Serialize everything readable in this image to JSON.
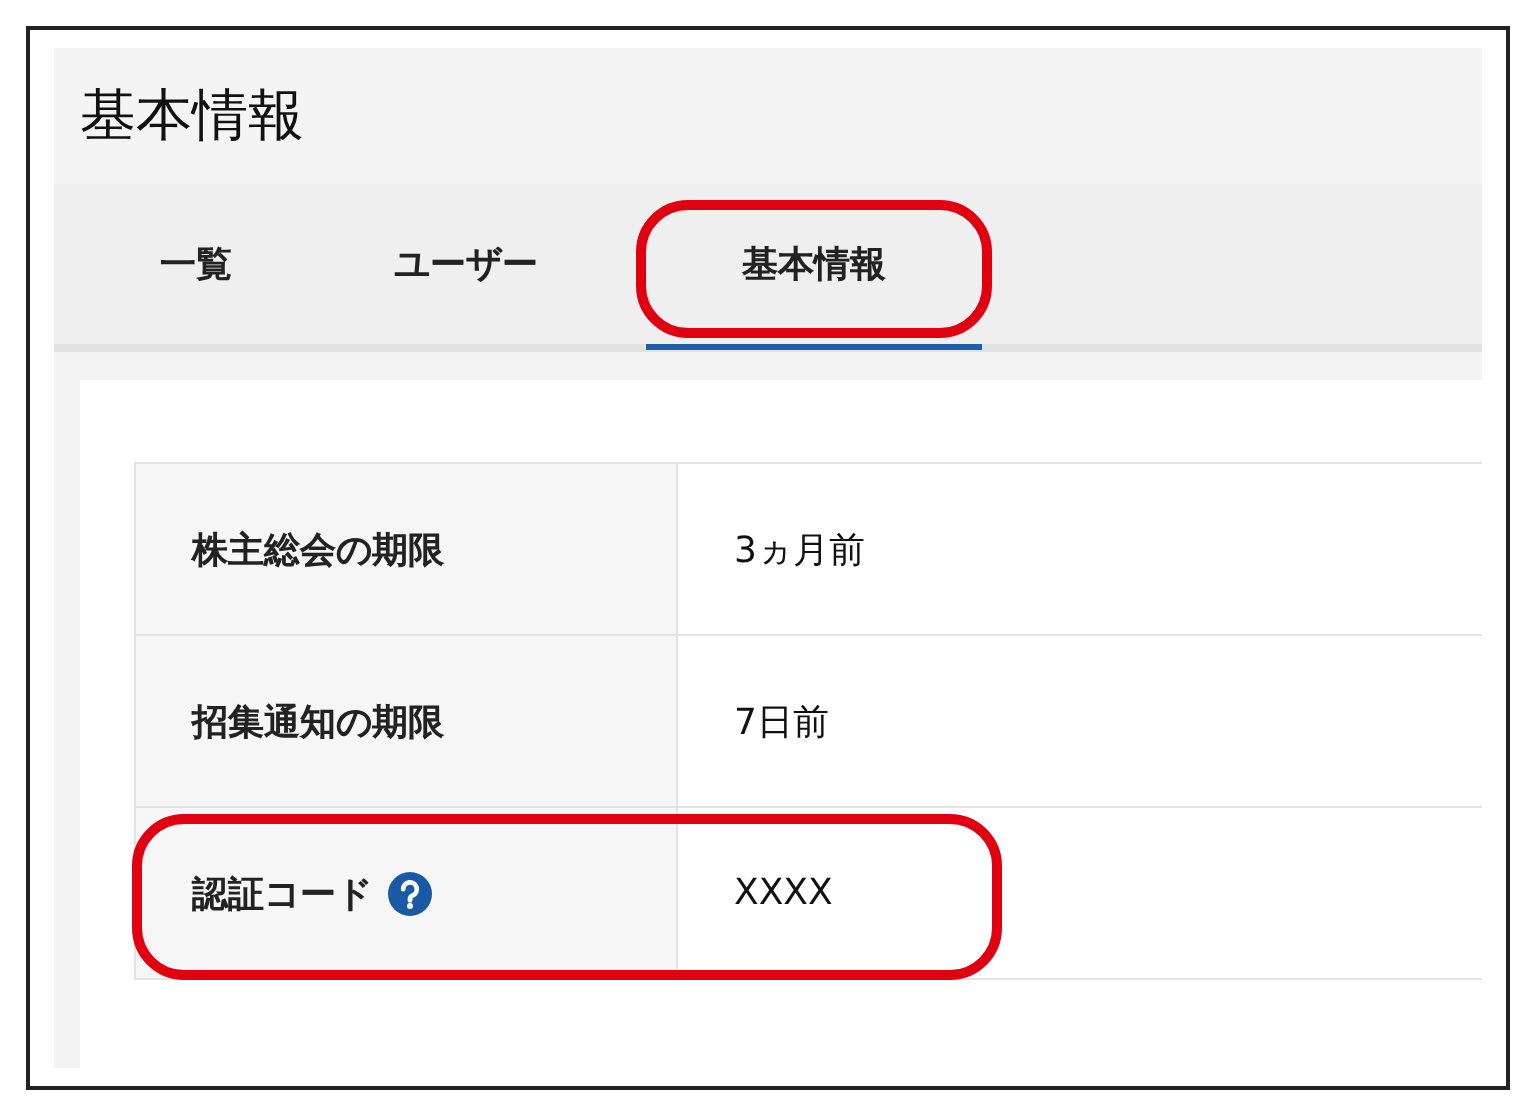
{
  "page": {
    "title": "基本情報"
  },
  "tabs": [
    {
      "label": "一覧",
      "selected": false,
      "highlighted": false
    },
    {
      "label": "ユーザー",
      "selected": false,
      "highlighted": false
    },
    {
      "label": "基本情報",
      "selected": true,
      "highlighted": true
    }
  ],
  "rows": [
    {
      "label": "株主総会の期限",
      "value": "3ヵ月前",
      "help": false,
      "highlighted": false
    },
    {
      "label": "招集通知の期限",
      "value": "7日前",
      "help": false,
      "highlighted": false
    },
    {
      "label": "認証コード",
      "value": "XXXX",
      "help": true,
      "highlighted": true
    }
  ]
}
